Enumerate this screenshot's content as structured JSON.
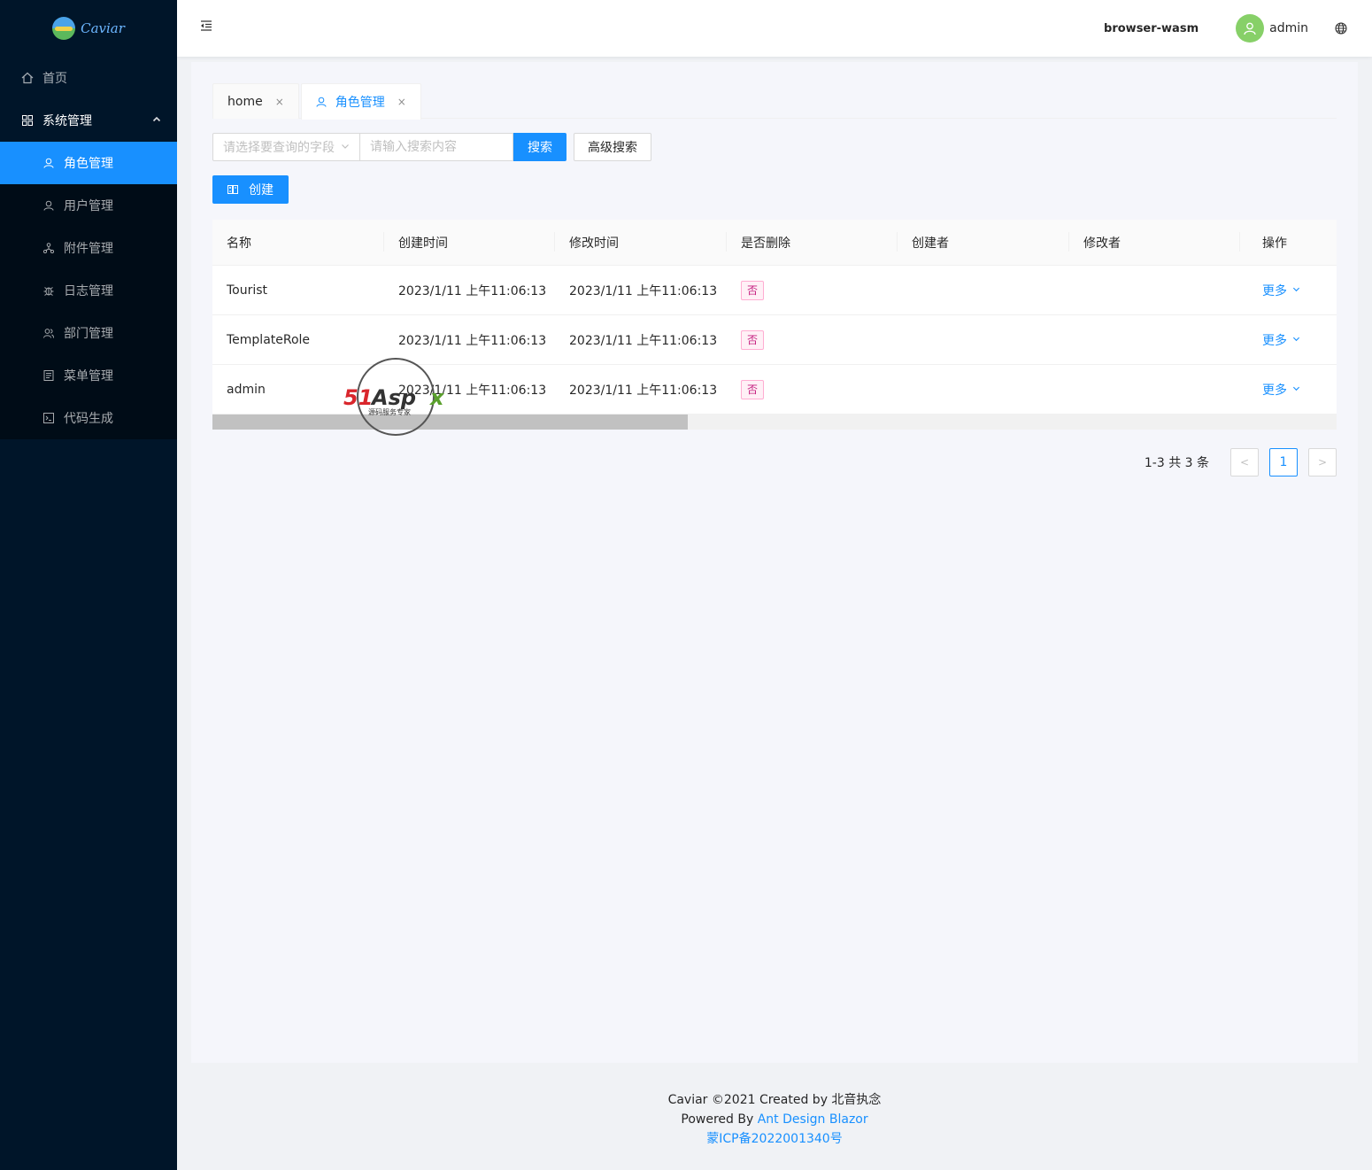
{
  "app": {
    "logo_text": "Caviar"
  },
  "sidebar": {
    "home": {
      "label": "首页",
      "icon": "home-icon"
    },
    "system": {
      "label": "系统管理",
      "icon": "appstore-icon",
      "expanded": true
    },
    "items": [
      {
        "label": "角色管理",
        "icon": "user-icon",
        "active": true
      },
      {
        "label": "用户管理",
        "icon": "user-icon"
      },
      {
        "label": "附件管理",
        "icon": "cluster-icon"
      },
      {
        "label": "日志管理",
        "icon": "bug-icon"
      },
      {
        "label": "部门管理",
        "icon": "team-icon"
      },
      {
        "label": "菜单管理",
        "icon": "profile-icon"
      },
      {
        "label": "代码生成",
        "icon": "code-icon"
      }
    ]
  },
  "header": {
    "env": "browser-wasm",
    "user": "admin"
  },
  "tabs": [
    {
      "label": "home",
      "close": "×"
    },
    {
      "label": "角色管理",
      "close": "×",
      "active": true
    }
  ],
  "search": {
    "field_placeholder": "请选择要查询的字段",
    "input_placeholder": "请输入搜索内容",
    "search_label": "搜索",
    "advanced_label": "高级搜索",
    "create_label": "创建"
  },
  "table": {
    "columns": [
      "名称",
      "创建时间",
      "修改时间",
      "是否删除",
      "创建者",
      "修改者",
      "操作"
    ],
    "rows": [
      {
        "name": "Tourist",
        "created": "2023/1/11 上午11:06:13",
        "modified": "2023/1/11 上午11:06:13",
        "deleted": "否",
        "creator": "",
        "modifier": "",
        "action": "更多"
      },
      {
        "name": "TemplateRole",
        "created": "2023/1/11 上午11:06:13",
        "modified": "2023/1/11 上午11:06:13",
        "deleted": "否",
        "creator": "",
        "modifier": "",
        "action": "更多"
      },
      {
        "name": "admin",
        "created": "2023/1/11 上午11:06:13",
        "modified": "2023/1/11 上午11:06:13",
        "deleted": "否",
        "creator": "",
        "modifier": "",
        "action": "更多"
      }
    ]
  },
  "pagination": {
    "total_text": "1-3 共 3 条",
    "current": "1",
    "prev": "<",
    "next": ">"
  },
  "watermark": {
    "brand": "51Aspx",
    "tagline": "源码服务专家"
  },
  "footer": {
    "line1": "Caviar ©2021 Created by 北音执念",
    "powered_prefix": "Powered By",
    "powered_link": "Ant Design Blazor",
    "icp": "蒙ICP备2022001340号"
  },
  "colors": {
    "primary": "#1890ff",
    "sider": "#001529",
    "tag_bg": "#fff0f6",
    "tag_text": "#c41d7f",
    "avatar": "#87d068"
  }
}
